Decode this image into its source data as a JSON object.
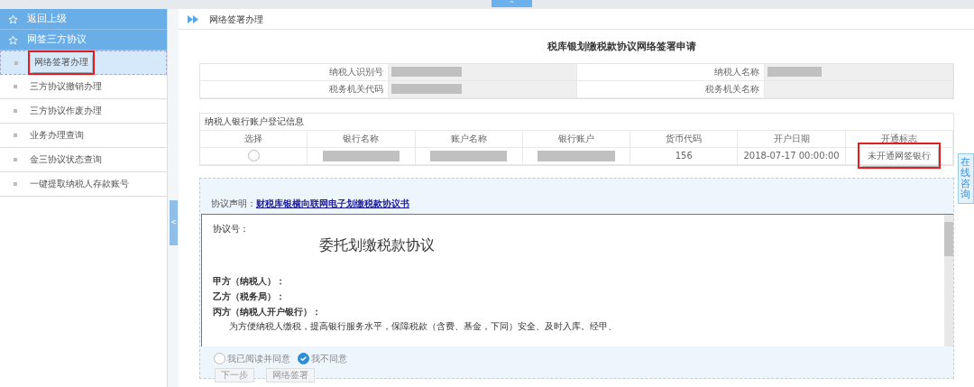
{
  "collapse_tab": {
    "label": "^"
  },
  "sidebar": {
    "headers": [
      {
        "label": "返回上级"
      },
      {
        "label": "网签三方协议"
      }
    ],
    "items": [
      {
        "label": "网络签署办理",
        "selected": true,
        "highlighted": true
      },
      {
        "label": "三方协议撤销办理",
        "selected": false,
        "highlighted": false
      },
      {
        "label": "三方协议作废办理",
        "selected": false,
        "highlighted": false
      },
      {
        "label": "业务办理查询",
        "selected": false,
        "highlighted": false
      },
      {
        "label": "金三协议状态查询",
        "selected": false,
        "highlighted": false
      },
      {
        "label": "一键提取纳税人存款账号",
        "selected": false,
        "highlighted": false
      }
    ]
  },
  "sidebar_toggle": {
    "label": "<"
  },
  "breadcrumb": "网络签署办理",
  "form_title": "税库银划缴税款协议网络签署申请",
  "taxpayer_info": [
    {
      "label": "纳税人识别号",
      "redacted": true
    },
    {
      "label": "纳税人名称",
      "redacted": true
    },
    {
      "label": "税务机关代码",
      "redacted": true
    },
    {
      "label": "税务机关名称",
      "redacted": false
    }
  ],
  "bank_accounts": {
    "title": "纳税人银行账户登记信息",
    "columns": [
      "选择",
      "银行名称",
      "账户名称",
      "银行账户",
      "货币代码",
      "开户日期",
      "开通标志"
    ],
    "rows": [
      {
        "cells": [
          {
            "kind": "radio",
            "selected": false
          },
          {
            "kind": "redacted"
          },
          {
            "kind": "redacted"
          },
          {
            "kind": "redacted"
          },
          {
            "kind": "text",
            "value": "156",
            "highlighted": false
          },
          {
            "kind": "text",
            "value": "2018-07-17 00:00:00",
            "highlighted": false
          },
          {
            "kind": "text",
            "value": "未开通网签银行",
            "highlighted": true
          }
        ]
      }
    ]
  },
  "agreement": {
    "label": "协议声明：",
    "link": "财税库银横向联网电子划缴税款协议书",
    "document": {
      "number_label": "协议号：",
      "title": "委托划缴税款协议",
      "parties": [
        "甲方（纳税人）：",
        "乙方（税务局）：",
        "丙方（纳税人开户银行）："
      ],
      "paragraph": "为方便纳税人缴税，提高银行服务水平，保障税款（含费、基金，下同）安全、及时入库。经甲、"
    },
    "options": [
      {
        "label": "我已阅读并同意",
        "selected": false
      },
      {
        "label": "我不同意",
        "selected": true
      }
    ],
    "buttons": [
      {
        "label": "下一步",
        "disabled": true
      },
      {
        "label": "网络签署",
        "disabled": true
      }
    ]
  },
  "side_tab": {
    "label": "在线咨询"
  }
}
